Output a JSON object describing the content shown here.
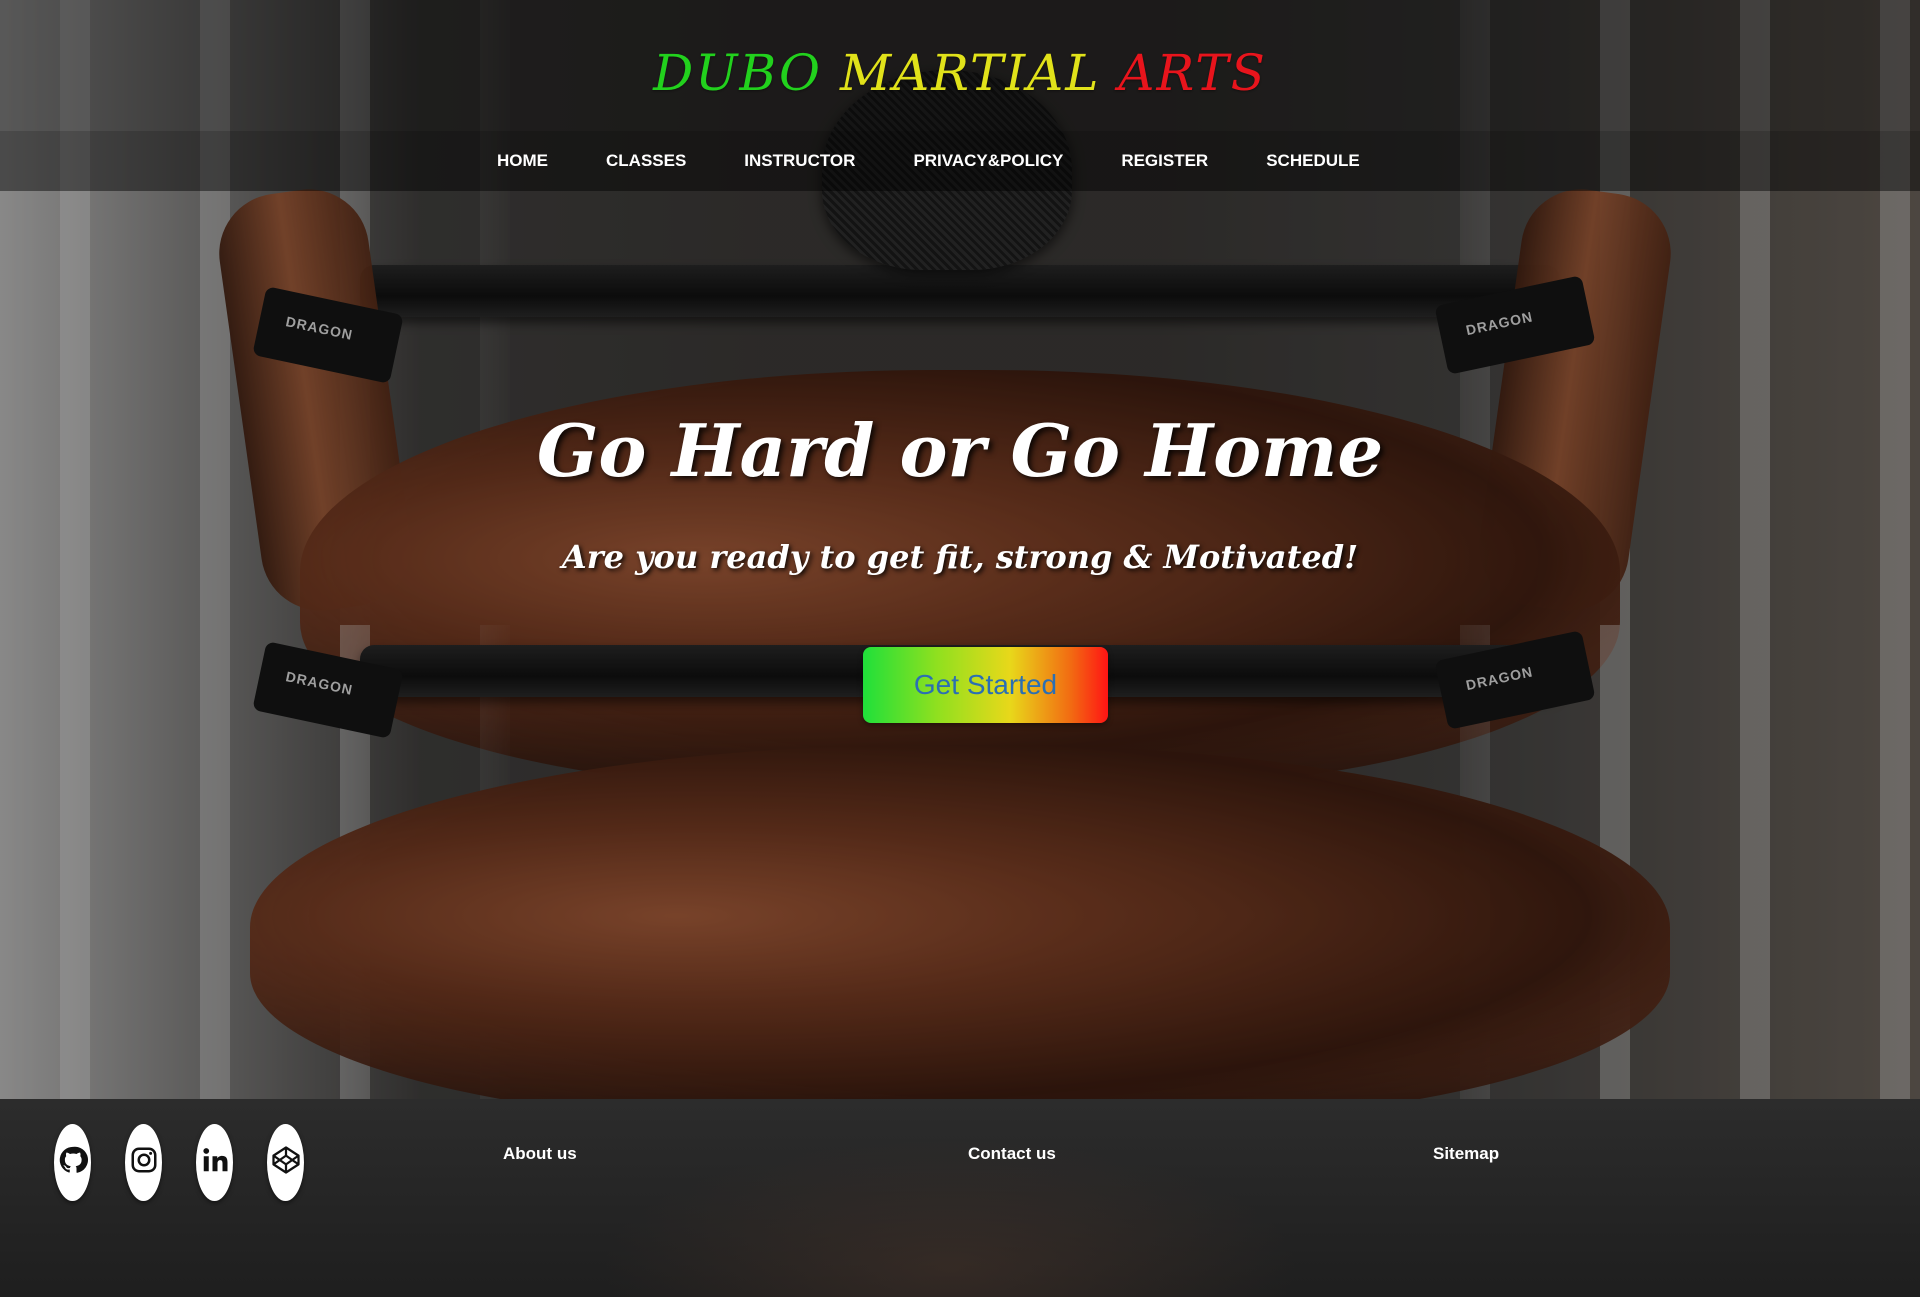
{
  "brand": {
    "words": [
      {
        "text": "DUBO",
        "color": "#22d11d"
      },
      {
        "text": "MARTIAL",
        "color": "#e1e21a"
      },
      {
        "text": "ARTS",
        "color": "#e8141c"
      }
    ]
  },
  "nav": {
    "items": [
      {
        "label": "HOME"
      },
      {
        "label": "CLASSES"
      },
      {
        "label": "INSTRUCTOR"
      },
      {
        "label": "PRIVACY&POLICY"
      },
      {
        "label": "REGISTER"
      },
      {
        "label": "SCHEDULE"
      }
    ]
  },
  "hero": {
    "title": "Go Hard or Go Home",
    "subtitle": "Are you ready to get fit, strong & Motivated!",
    "cta_label": "Get Started",
    "strap_text": "DRAGON"
  },
  "footer": {
    "socials": [
      {
        "icon": "github-icon"
      },
      {
        "icon": "instagram-icon"
      },
      {
        "icon": "linkedin-icon"
      },
      {
        "icon": "codepen-icon"
      }
    ],
    "links": [
      {
        "label": "About us"
      },
      {
        "label": "Contact us"
      },
      {
        "label": "Sitemap"
      }
    ]
  },
  "colors": {
    "cta_text": "#2b6fb3",
    "nav_bg": "rgba(0,0,0,0.45)",
    "footer_bg": "#2a2a2a"
  }
}
